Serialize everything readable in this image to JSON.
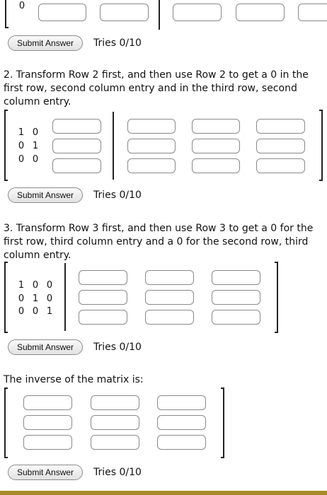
{
  "buttons": {
    "submit_label": "Submit Answer"
  },
  "tries": {
    "label": "Tries 0/10"
  },
  "step_top": {
    "row_value": "0"
  },
  "step2": {
    "instruction": "2. Transform Row 2 first, and then use Row 2 to get a 0 in the first row, second column entry and in the third row, second column entry.",
    "matrix_left": [
      [
        "1",
        "0"
      ],
      [
        "0",
        "1"
      ],
      [
        "0",
        "0"
      ]
    ]
  },
  "step3": {
    "instruction": "3. Transform Row 3 first, and then use Row 3 to get a 0 for the first row, third column entry and a 0 for the second row, third column entry.",
    "matrix_left": [
      [
        "1",
        "0",
        "0"
      ],
      [
        "0",
        "1",
        "0"
      ],
      [
        "0",
        "0",
        "1"
      ]
    ]
  },
  "inverse": {
    "instruction": "The inverse of the matrix is:"
  },
  "colors": {
    "accent_bar": "#a88a2a",
    "input_border": "#8a8a8a"
  }
}
